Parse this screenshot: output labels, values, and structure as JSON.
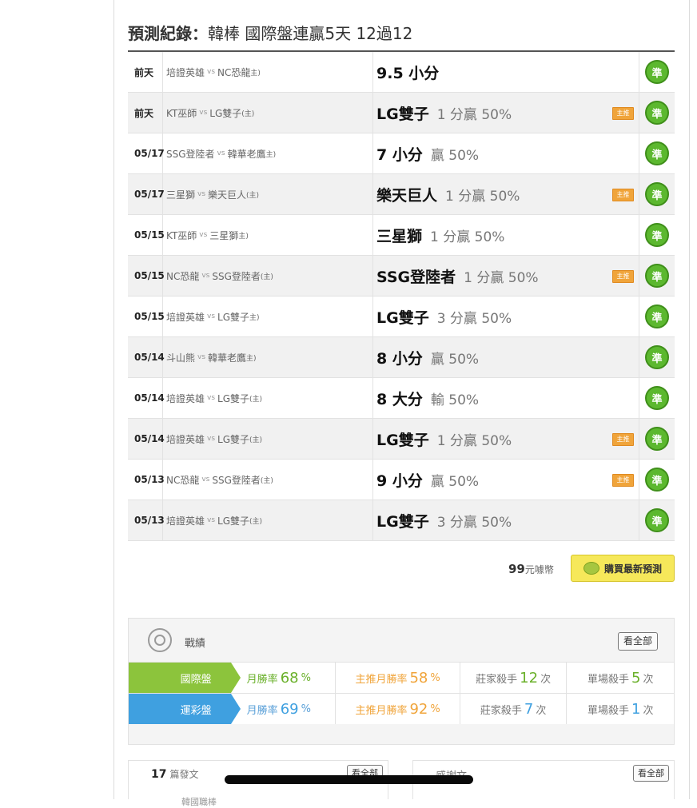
{
  "title_bold": "預測紀錄：",
  "title_rest": "韓棒 國際盤連贏5天 12過12",
  "rows": [
    {
      "date": "前天",
      "away": "培證英雄",
      "vs": "vs",
      "home": "NC恐龍",
      "home_tag": "主)",
      "pick": "9.5 小分",
      "extra": "",
      "featured": false,
      "badge": "準"
    },
    {
      "date": "前天",
      "away": "KT巫師",
      "vs": "vs",
      "home": "LG雙子",
      "home_tag": "(主)",
      "pick": "LG雙子",
      "extra": "1 分贏 50%",
      "featured": true,
      "badge": "準"
    },
    {
      "date": "05/17",
      "away": "SSG登陸者",
      "vs": "vs",
      "home": "韓華老鷹",
      "home_tag": "主)",
      "pick": "7 小分",
      "extra": "贏 50%",
      "featured": false,
      "badge": "準"
    },
    {
      "date": "05/17",
      "away": "三星獅",
      "vs": "vs",
      "home": "樂天巨人",
      "home_tag": "(主)",
      "pick": "樂天巨人",
      "extra": "1 分贏 50%",
      "featured": true,
      "badge": "準"
    },
    {
      "date": "05/15",
      "away": "KT巫師",
      "vs": "vs",
      "home": "三星獅",
      "home_tag": "主)",
      "pick": "三星獅",
      "extra": "1 分贏 50%",
      "featured": false,
      "badge": "準"
    },
    {
      "date": "05/15",
      "away": "NC恐龍",
      "vs": "vs",
      "home": "SSG登陸者",
      "home_tag": "(主)",
      "pick": "SSG登陸者",
      "extra": "1 分贏 50%",
      "featured": true,
      "badge": "準"
    },
    {
      "date": "05/15",
      "away": "培證英雄",
      "vs": "vs",
      "home": "LG雙子",
      "home_tag": "主)",
      "pick": "LG雙子",
      "extra": "3 分贏 50%",
      "featured": false,
      "badge": "準"
    },
    {
      "date": "05/14",
      "away": "斗山熊",
      "vs": "vs",
      "home": "韓華老鷹",
      "home_tag": "主)",
      "pick": "8 小分",
      "extra": "贏 50%",
      "featured": false,
      "badge": "準"
    },
    {
      "date": "05/14",
      "away": "培證英雄",
      "vs": "vs",
      "home": "LG雙子",
      "home_tag": "(主)",
      "pick": "8 大分",
      "extra": "輸 50%",
      "featured": false,
      "badge": "準"
    },
    {
      "date": "05/14",
      "away": "培證英雄",
      "vs": "vs",
      "home": "LG雙子",
      "home_tag": "(主)",
      "pick": "LG雙子",
      "extra": "1 分贏 50%",
      "featured": true,
      "badge": "準"
    },
    {
      "date": "05/13",
      "away": "NC恐龍",
      "vs": "vs",
      "home": "SSG登陸者",
      "home_tag": "(主)",
      "pick": "9 小分",
      "extra": "贏 50%",
      "featured": true,
      "badge": "準"
    },
    {
      "date": "05/13",
      "away": "培證英雄",
      "vs": "vs",
      "home": "LG雙子",
      "home_tag": "(主)",
      "pick": "LG雙子",
      "extra": "3 分贏 50%",
      "featured": false,
      "badge": "準"
    }
  ],
  "featured_tag": "主推",
  "price": {
    "amount": "99",
    "unit": "元噱幣"
  },
  "buy_button": "購買最新預測",
  "stats": {
    "header": "戰績",
    "view_all": "看全部",
    "rows": [
      {
        "label": "國際盤",
        "monthly_label": "月勝率",
        "monthly_value": "68",
        "monthly_unit": "%",
        "featured_label": "主推月勝率",
        "featured_value": "58",
        "featured_unit": "%",
        "killer_label": "莊家殺手",
        "killer_value": "12",
        "killer_unit": "次",
        "single_label": "單場殺手",
        "single_value": "5",
        "single_unit": "次"
      },
      {
        "label": "運彩盤",
        "monthly_label": "月勝率",
        "monthly_value": "69",
        "monthly_unit": "%",
        "featured_label": "主推月勝率",
        "featured_value": "92",
        "featured_unit": "%",
        "killer_label": "莊家殺手",
        "killer_value": "7",
        "killer_unit": "次",
        "single_label": "單場殺手",
        "single_value": "1",
        "single_unit": "次"
      }
    ]
  },
  "posts": {
    "count": "17",
    "label": "篇發文",
    "view_all": "看全部",
    "peek": "韓國職棒"
  },
  "thanks": {
    "label": "感謝文",
    "view_all": "看全部"
  },
  "colors": {
    "accent_green": "#5cb82f",
    "tag_orange": "#f0a43a",
    "intl_green": "#8cc43c",
    "lottery_blue": "#3fa0e0",
    "buy_yellow": "#f6e85a"
  }
}
